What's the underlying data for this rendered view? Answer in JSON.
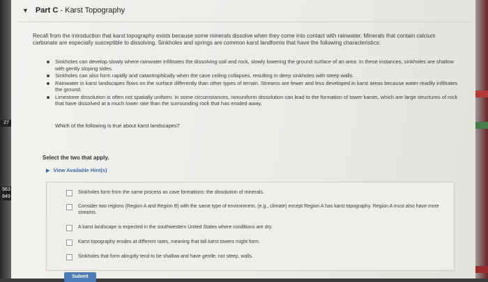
{
  "page": {
    "part_label": "Part C",
    "part_title": " - Karst Topography",
    "intro": "Recall from the introduction that karst topography exists because some minerals dissolve when they come into contact with rainwater. Minerals that contain calcium carbonate are especially susceptible to dissolving. Sinkholes and springs are common karst landforms that have the following characteristics:",
    "bullets": [
      "Sinkholes can develop slowly where rainwater infiltrates the dissolving soil and rock, slowly lowering the ground surface of an area. In these instances, sinkholes are shallow with gently sloping sides.",
      "Sinkholes can also form rapidly and catastrophically when the cave ceiling collapses, resulting in deep sinkholes with steep walls.",
      "Rainwater in karst landscapes flows on the surface differently than other types of terrain. Streams are fewer and less developed in karst areas because water readily infiltrates the ground.",
      "Limestone dissolution is often not spatially uniform. In some circumstances, nonuniform dissolution can lead to the formation of tower karsts, which are large structures of rock that have dissolved at a much lower rate than the surrounding rock that has eroded away."
    ],
    "question": "Which of the following is true about karst landscapes?",
    "instruction": "Select the two that apply.",
    "hints_label": "View Available Hint(s)",
    "options": [
      "Sinkholes form from the same process as cave formations: the dissolution of minerals.",
      "Consider two regions (Region A and Region B) with the same type of environment, (e.g., climate) except Region A has karst topography. Region A must also have more streams.",
      "A karst landscape is expected in the southwestern United States where conditions are dry.",
      "Karst topography erodes at different rates, meaning that tall karst towers might form.",
      "Sinkholes that form abruptly tend to be shallow and have gentle, not steep, walls."
    ],
    "submit_label": "Submit"
  },
  "edges": {
    "left_numbers": [
      "27",
      "563",
      "849"
    ]
  }
}
